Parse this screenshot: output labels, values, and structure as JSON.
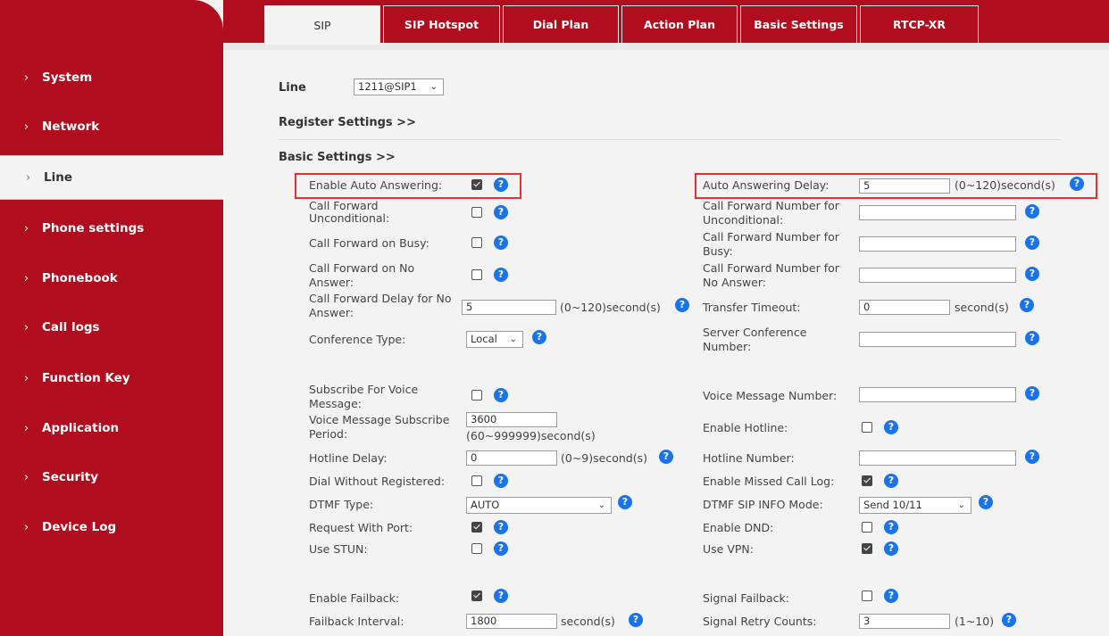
{
  "sidebar": {
    "items": [
      {
        "label": "System"
      },
      {
        "label": "Network"
      },
      {
        "label": "Line"
      },
      {
        "label": "Phone settings"
      },
      {
        "label": "Phonebook"
      },
      {
        "label": "Call logs"
      },
      {
        "label": "Function Key"
      },
      {
        "label": "Application"
      },
      {
        "label": "Security"
      },
      {
        "label": "Device Log"
      }
    ],
    "chevron": "›"
  },
  "tabs": [
    {
      "label": "SIP"
    },
    {
      "label": "SIP Hotspot"
    },
    {
      "label": "Dial Plan"
    },
    {
      "label": "Action Plan"
    },
    {
      "label": "Basic Settings"
    },
    {
      "label": "RTCP-XR"
    }
  ],
  "line": {
    "label": "Line",
    "value": "1211@SIP1"
  },
  "sections": {
    "register": "Register Settings >>",
    "basic": "Basic Settings >>"
  },
  "help_glyph": "?",
  "arrow_glyph": "⌄",
  "fields": {
    "enable_auto_answering": "Enable Auto Answering:",
    "auto_answering_delay": "Auto Answering Delay:",
    "auto_answering_delay_value": "5",
    "auto_answering_delay_unit": "(0~120)second(s)",
    "cf_unconditional": [
      "Call Forward",
      "Unconditional:"
    ],
    "cf_number_unconditional": [
      "Call Forward Number for",
      "Unconditional:"
    ],
    "cf_busy": "Call Forward on Busy:",
    "cf_number_busy": [
      "Call Forward Number for",
      "Busy:"
    ],
    "cf_no_answer": [
      "Call Forward on No",
      "Answer:"
    ],
    "cf_number_no_answer": [
      "Call Forward Number for",
      "No Answer:"
    ],
    "cf_delay": [
      "Call Forward Delay for No",
      "Answer:"
    ],
    "cf_delay_value": "5",
    "cf_delay_unit": "(0~120)second(s)",
    "transfer_timeout": "Transfer Timeout:",
    "transfer_timeout_value": "0",
    "transfer_timeout_unit": "second(s)",
    "conference_type": "Conference Type:",
    "conference_type_value": "Local",
    "server_conference": [
      "Server Conference",
      "Number:"
    ],
    "subscribe_voice": [
      "Subscribe For Voice",
      "Message:"
    ],
    "voice_message_number": "Voice Message Number:",
    "vm_subscribe_period": [
      "Voice Message Subscribe",
      "Period:"
    ],
    "vm_subscribe_period_value": "3600",
    "vm_subscribe_period_unit": "(60~999999)second(s)",
    "enable_hotline": "Enable Hotline:",
    "hotline_delay": "Hotline Delay:",
    "hotline_delay_value": "0",
    "hotline_delay_unit": "(0~9)second(s)",
    "hotline_number": "Hotline Number:",
    "dial_without_registered": "Dial Without Registered:",
    "enable_missed_call_log": "Enable Missed Call Log:",
    "dtmf_type": "DTMF Type:",
    "dtmf_type_value": "AUTO",
    "dtmf_sip_info_mode": "DTMF SIP INFO Mode:",
    "dtmf_sip_info_mode_value": "Send 10/11",
    "request_with_port": "Request With Port:",
    "enable_dnd": "Enable DND:",
    "use_stun": "Use STUN:",
    "use_vpn": "Use VPN:",
    "enable_failback": "Enable Failback:",
    "signal_failback": "Signal Failback:",
    "failback_interval": "Failback Interval:",
    "failback_interval_value": "1800",
    "failback_interval_unit": "second(s)",
    "signal_retry_counts": "Signal Retry Counts:",
    "signal_retry_counts_value": "3",
    "signal_retry_counts_unit": "(1~10)"
  },
  "colors": {
    "brand": "#b00d1e",
    "help": "#1a73e8",
    "highlight": "#e23333"
  }
}
